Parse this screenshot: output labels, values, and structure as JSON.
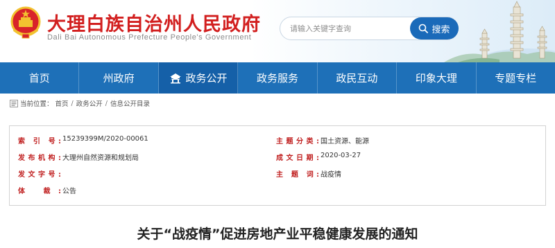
{
  "header": {
    "title": "大理白族自治州人民政府",
    "subtitle": "Dali Bai Autonomous Prefecture People's Government",
    "search": {
      "placeholder": "请输入关键字查询",
      "button_label": "搜索"
    }
  },
  "nav": {
    "items": [
      {
        "label": "首页"
      },
      {
        "label": "州政府"
      },
      {
        "label": "政务公开"
      },
      {
        "label": "政务服务"
      },
      {
        "label": "政民互动"
      },
      {
        "label": "印象大理"
      },
      {
        "label": "专题专栏"
      }
    ]
  },
  "breadcrumb": {
    "prefix": "当前位置：",
    "items": [
      "首页",
      "政务公开",
      "信息公开目录"
    ],
    "separator": "/"
  },
  "info": {
    "index_label": "索 引 号:",
    "index_value": "15239399M/2020-00061",
    "publisher_label": "发布机构:",
    "publisher_value": "大理州自然资源和规划局",
    "doc_no_label": "发文字号:",
    "doc_no_value": "",
    "genre_label": "体    裁:",
    "genre_value": "公告",
    "category_label": "主题分类:",
    "category_value": "国土资源、能源",
    "date_label": "成文日期:",
    "date_value": "2020-03-27",
    "subject_label": "主    题  词:",
    "subject_value": "战疫情"
  },
  "article": {
    "title": "关于“战疫情”促进房地产业平稳健康发展的通知"
  },
  "colors": {
    "brand_red": "#d21f1f",
    "nav_blue": "#1e70b8",
    "search_blue": "#1a6ab9",
    "label_red": "#c01f1f"
  }
}
